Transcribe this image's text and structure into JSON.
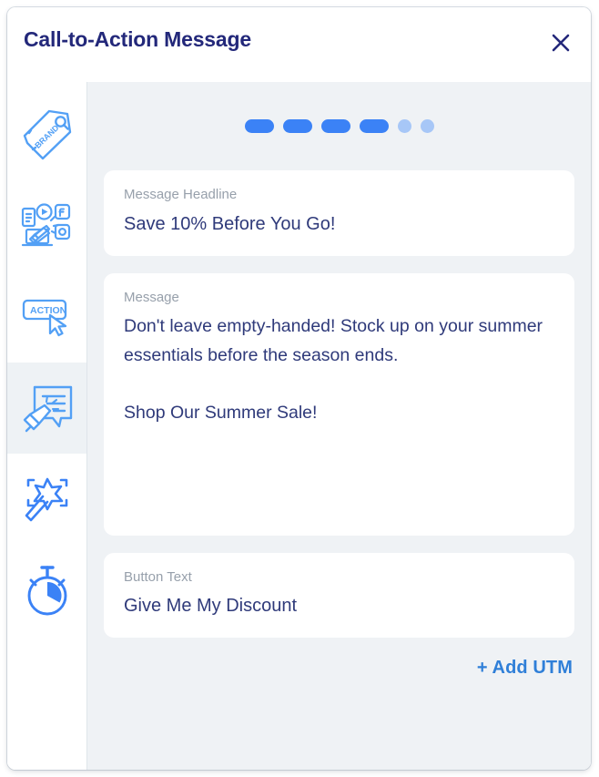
{
  "modal": {
    "title": "Call-to-Action Message",
    "close_label": "Close",
    "close_icon": "close-icon"
  },
  "sidebar": {
    "items": [
      {
        "id": "brand",
        "icon": "brand-tag-icon",
        "label": "Brand",
        "active": false
      },
      {
        "id": "channels",
        "icon": "media-channels-icon",
        "label": "Channels",
        "active": false
      },
      {
        "id": "action",
        "icon": "action-button-icon",
        "label": "Action",
        "active": false
      },
      {
        "id": "message",
        "icon": "message-megaphone-icon",
        "label": "Message",
        "active": true
      },
      {
        "id": "magic",
        "icon": "magic-wand-icon",
        "label": "Generate",
        "active": false
      },
      {
        "id": "timing",
        "icon": "stopwatch-icon",
        "label": "Timing",
        "active": false
      }
    ]
  },
  "steps": {
    "total": 6,
    "completed": 4,
    "items": [
      {
        "state": "done"
      },
      {
        "state": "done"
      },
      {
        "state": "done"
      },
      {
        "state": "done"
      },
      {
        "state": "pending"
      },
      {
        "state": "pending"
      }
    ]
  },
  "fields": {
    "headline": {
      "label": "Message Headline",
      "value": "Save 10% Before You Go!"
    },
    "message": {
      "label": "Message",
      "value": "Don't leave empty-handed! Stock up on your summer essentials before the season ends.\n\nShop Our Summer Sale!"
    },
    "button_text": {
      "label": "Button Text",
      "value": "Give Me My Discount"
    }
  },
  "footer": {
    "add_utm_label": "+ Add UTM"
  },
  "colors": {
    "accent_blue": "#3b82f6",
    "accent_blue_light": "#a7c7f7",
    "title_navy": "#23287a",
    "text_navy": "#2f3a7a",
    "label_gray": "#97a0ab",
    "panel_bg": "#eff2f5",
    "link_blue": "#2f7fd8"
  }
}
